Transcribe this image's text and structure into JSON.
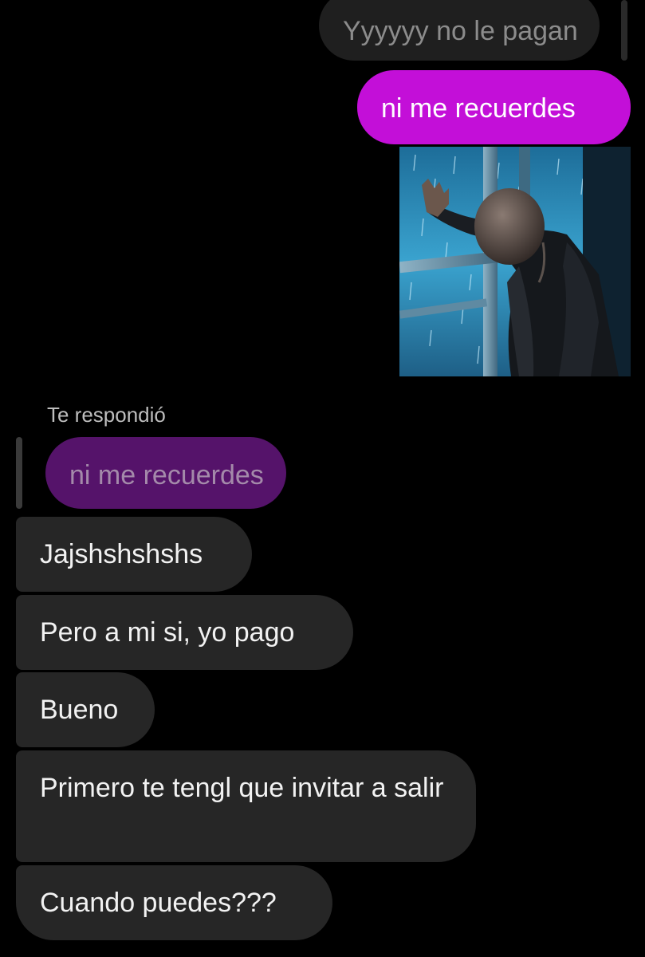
{
  "quoted_outgoing": {
    "text": "Yyyyyy no le pagan"
  },
  "outgoing_message": {
    "text": "ni me recuerdes"
  },
  "reply_block": {
    "label": "Te respondió",
    "quoted_text": "ni me recuerdes"
  },
  "incoming_messages": [
    {
      "text": "Jajshshshshs"
    },
    {
      "text": "Pero a mi si, yo pago"
    },
    {
      "text": "Bueno"
    },
    {
      "text": "Primero te tengl que invitar a salir"
    },
    {
      "text": "Cuando puedes???"
    }
  ],
  "colors": {
    "background": "#000000",
    "outgoing_bubble": "#c30fd8",
    "incoming_bubble": "#262626",
    "quoted_reply_bubble": "#55136a"
  }
}
